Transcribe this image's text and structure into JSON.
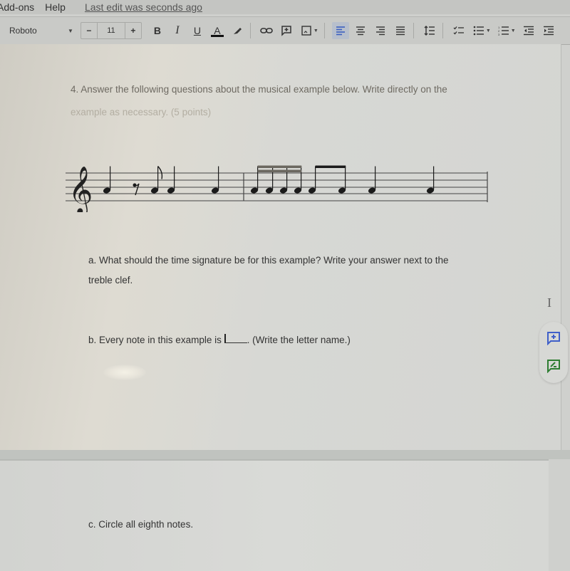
{
  "menubar": {
    "items": [
      "Add-ons",
      "Help"
    ],
    "last_edit": "Last edit was seconds ago"
  },
  "toolbar": {
    "font": "Roboto",
    "font_size": "11",
    "minus": "−",
    "plus": "+",
    "bold": "B",
    "italic": "I",
    "underline": "U",
    "text_color": "A",
    "text_color_value": "#111111",
    "accent": "#3b5fc0",
    "active_alignment": "left"
  },
  "document": {
    "question_title_dark": "4. Answer the following questions about the musical example below. Write directly on the",
    "question_title_light": "example as necessary. (5 points)",
    "question_a_line1": "a. What should the time signature be for this example? Write your answer next to the",
    "question_a_line2": "treble clef.",
    "question_b_prefix": "b. Every note in this example is ",
    "question_b_suffix": ". (Write the letter name.)",
    "question_c": "c. Circle all eighth notes."
  },
  "music": {
    "clef": "treble",
    "pitch": "A4",
    "measures": [
      {
        "events": [
          "quarter",
          "eighth-rest",
          "eighth",
          "quarter",
          "quarter"
        ]
      },
      {
        "events": [
          "sixteenth",
          "sixteenth",
          "sixteenth",
          "sixteenth",
          "eighth",
          "eighth",
          "quarter",
          "quarter"
        ]
      }
    ]
  },
  "side_actions": {
    "add_comment": "add-comment",
    "suggest_edit": "suggest-edit",
    "add_comment_color": "#3f5fc9",
    "suggest_edit_color": "#2e7d32"
  }
}
